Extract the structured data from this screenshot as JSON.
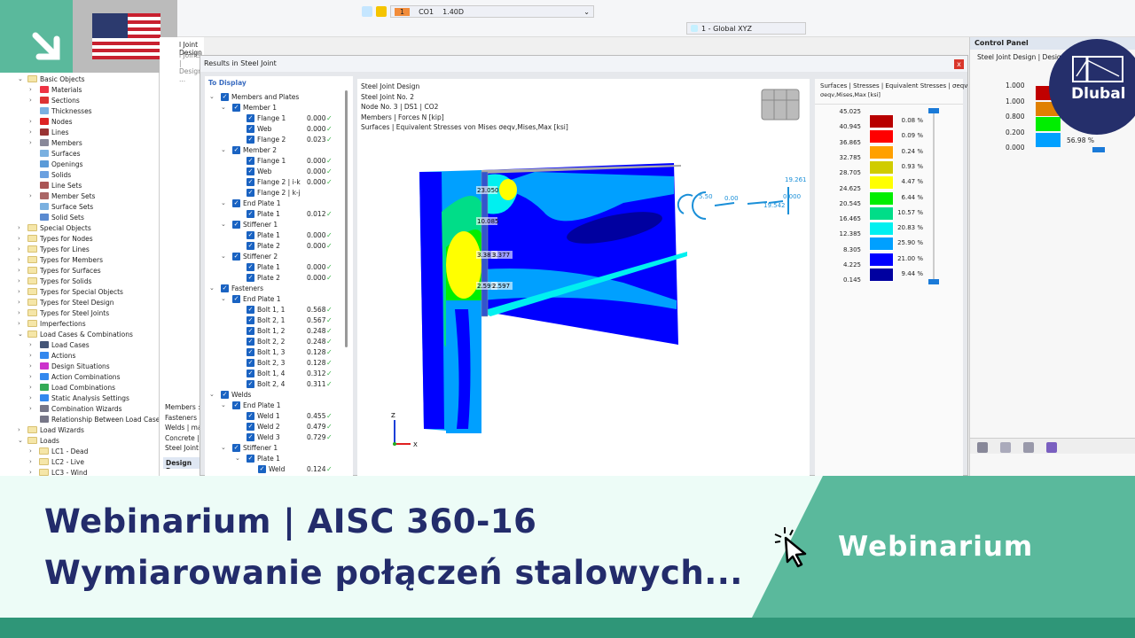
{
  "banner": {
    "line1": "Webinarium | AISC 360-16",
    "line2": "Wymiarowanie połączeń stalowych...",
    "badge": "Webinarium",
    "logo": "Dlubal",
    "colors": {
      "green": "#5ab99c",
      "dark_green": "#2f9678",
      "navy": "#232c6b",
      "mint": "#edfcf7"
    }
  },
  "toolbar": {
    "lc_number": "1",
    "lc_name": "CO1",
    "lc_factor": "1.40D",
    "coord_system": "1 - Global XYZ"
  },
  "left_tree": [
    {
      "l": 0,
      "e": "v",
      "i": "folder",
      "t": "Basic Objects"
    },
    {
      "l": 1,
      "e": ">",
      "i": "#e34",
      "t": "Materials"
    },
    {
      "l": 1,
      "e": ">",
      "i": "#d33",
      "t": "Sections"
    },
    {
      "l": 1,
      "e": "",
      "i": "#7ab0e0",
      "t": "Thicknesses"
    },
    {
      "l": 1,
      "e": ">",
      "i": "#d22",
      "t": "Nodes"
    },
    {
      "l": 1,
      "e": ">",
      "i": "#933",
      "t": "Lines"
    },
    {
      "l": 1,
      "e": ">",
      "i": "#889",
      "t": "Members"
    },
    {
      "l": 1,
      "e": "",
      "i": "#7ab0e0",
      "t": "Surfaces"
    },
    {
      "l": 1,
      "e": "",
      "i": "#5a9ad8",
      "t": "Openings"
    },
    {
      "l": 1,
      "e": "",
      "i": "#6aa0e0",
      "t": "Solids"
    },
    {
      "l": 1,
      "e": "",
      "i": "#a55",
      "t": "Line Sets"
    },
    {
      "l": 1,
      "e": ">",
      "i": "#a66",
      "t": "Member Sets"
    },
    {
      "l": 1,
      "e": "",
      "i": "#7ab0e0",
      "t": "Surface Sets"
    },
    {
      "l": 1,
      "e": "",
      "i": "#5a8ad0",
      "t": "Solid Sets"
    },
    {
      "l": 0,
      "e": ">",
      "i": "folder",
      "t": "Special Objects"
    },
    {
      "l": 0,
      "e": ">",
      "i": "folder",
      "t": "Types for Nodes"
    },
    {
      "l": 0,
      "e": ">",
      "i": "folder",
      "t": "Types for Lines"
    },
    {
      "l": 0,
      "e": ">",
      "i": "folder",
      "t": "Types for Members"
    },
    {
      "l": 0,
      "e": ">",
      "i": "folder",
      "t": "Types for Surfaces"
    },
    {
      "l": 0,
      "e": ">",
      "i": "folder",
      "t": "Types for Solids"
    },
    {
      "l": 0,
      "e": ">",
      "i": "folder",
      "t": "Types for Special Objects"
    },
    {
      "l": 0,
      "e": ">",
      "i": "folder",
      "t": "Types for Steel Design"
    },
    {
      "l": 0,
      "e": ">",
      "i": "folder",
      "t": "Types for Steel Joints"
    },
    {
      "l": 0,
      "e": ">",
      "i": "folder",
      "t": "Imperfections"
    },
    {
      "l": 0,
      "e": "v",
      "i": "folder",
      "t": "Load Cases & Combinations"
    },
    {
      "l": 1,
      "e": ">",
      "i": "#457",
      "t": "Load Cases"
    },
    {
      "l": 1,
      "e": ">",
      "i": "#38e",
      "t": "Actions"
    },
    {
      "l": 1,
      "e": ">",
      "i": "#c3c",
      "t": "Design Situations"
    },
    {
      "l": 1,
      "e": ">",
      "i": "#38e",
      "t": "Action Combinations"
    },
    {
      "l": 1,
      "e": ">",
      "i": "#3a5",
      "t": "Load Combinations"
    },
    {
      "l": 1,
      "e": ">",
      "i": "#38e",
      "t": "Static Analysis Settings"
    },
    {
      "l": 1,
      "e": ">",
      "i": "#778",
      "t": "Combination Wizards"
    },
    {
      "l": 1,
      "e": "",
      "i": "#778",
      "t": "Relationship Between Load Cases"
    },
    {
      "l": 0,
      "e": ">",
      "i": "folder",
      "t": "Load Wizards"
    },
    {
      "l": 0,
      "e": "v",
      "i": "folder",
      "t": "Loads"
    },
    {
      "l": 1,
      "e": ">",
      "i": "folder",
      "t": "LC1 - Dead"
    },
    {
      "l": 1,
      "e": ">",
      "i": "folder",
      "t": "LC2 - Live"
    },
    {
      "l": 1,
      "e": ">",
      "i": "folder",
      "t": "LC3 - Wind"
    }
  ],
  "mid_strip": {
    "header1": "l Joint Design",
    "header2": "l Joints | Design ...",
    "items": [
      "Members :",
      "Fasteners |",
      "Welds | ma",
      "Concrete |",
      "Steel Joint:"
    ],
    "design_tab": "Design Ra"
  },
  "dialog": {
    "title": "Results in Steel Joint",
    "close": "x",
    "to_display": "To Display"
  },
  "results_tree": [
    {
      "l": 0,
      "t": "Members and Plates",
      "v": ""
    },
    {
      "l": 1,
      "t": "Member 1",
      "v": ""
    },
    {
      "l": 2,
      "t": "Flange 1",
      "v": "0.000"
    },
    {
      "l": 2,
      "t": "Web",
      "v": "0.000"
    },
    {
      "l": 2,
      "t": "Flange 2",
      "v": "0.023"
    },
    {
      "l": 1,
      "t": "Member 2",
      "v": ""
    },
    {
      "l": 2,
      "t": "Flange 1",
      "v": "0.000"
    },
    {
      "l": 2,
      "t": "Web",
      "v": "0.000"
    },
    {
      "l": 2,
      "t": "Flange 2 | i-k",
      "v": "0.000"
    },
    {
      "l": 2,
      "t": "Flange 2 | k-j",
      "v": ""
    },
    {
      "l": 1,
      "t": "End Plate 1",
      "v": ""
    },
    {
      "l": 2,
      "t": "Plate 1",
      "v": "0.012"
    },
    {
      "l": 1,
      "t": "Stiffener 1",
      "v": ""
    },
    {
      "l": 2,
      "t": "Plate 1",
      "v": "0.000"
    },
    {
      "l": 2,
      "t": "Plate 2",
      "v": "0.000"
    },
    {
      "l": 1,
      "t": "Stiffener 2",
      "v": ""
    },
    {
      "l": 2,
      "t": "Plate 1",
      "v": "0.000"
    },
    {
      "l": 2,
      "t": "Plate 2",
      "v": "0.000"
    },
    {
      "l": 0,
      "t": "Fasteners",
      "v": ""
    },
    {
      "l": 1,
      "t": "End Plate 1",
      "v": ""
    },
    {
      "l": 2,
      "t": "Bolt 1, 1",
      "v": "0.568"
    },
    {
      "l": 2,
      "t": "Bolt 2, 1",
      "v": "0.567"
    },
    {
      "l": 2,
      "t": "Bolt 1, 2",
      "v": "0.248"
    },
    {
      "l": 2,
      "t": "Bolt 2, 2",
      "v": "0.248"
    },
    {
      "l": 2,
      "t": "Bolt 1, 3",
      "v": "0.128"
    },
    {
      "l": 2,
      "t": "Bolt 2, 3",
      "v": "0.128"
    },
    {
      "l": 2,
      "t": "Bolt 1, 4",
      "v": "0.312"
    },
    {
      "l": 2,
      "t": "Bolt 2, 4",
      "v": "0.311"
    },
    {
      "l": 0,
      "t": "Welds",
      "v": ""
    },
    {
      "l": 1,
      "t": "End Plate 1",
      "v": ""
    },
    {
      "l": 2,
      "t": "Weld 1",
      "v": "0.455"
    },
    {
      "l": 2,
      "t": "Weld 2",
      "v": "0.479"
    },
    {
      "l": 2,
      "t": "Weld 3",
      "v": "0.729"
    },
    {
      "l": 1,
      "t": "Stiffener 1",
      "v": ""
    },
    {
      "l": 2,
      "t": "Plate 1",
      "v": ""
    },
    {
      "l": 3,
      "t": "Weld",
      "v": "0.124"
    }
  ],
  "viewport": {
    "info": [
      "Steel Joint Design",
      "Steel Joint No. 2",
      "Node No. 3 | DS1 | CO2",
      "Members | Forces N [kip]",
      "Surfaces | Equivalent Stresses von Mises σeqv,Mises,Max [ksi]"
    ],
    "labels": [
      "23.050",
      "10.085",
      "3.383",
      "3.377",
      "2.599",
      "2.597"
    ],
    "forces": [
      "19.261",
      "0.000",
      "19.542",
      "0.00",
      "5.50"
    ],
    "axes": [
      "Z",
      "X"
    ]
  },
  "legend": {
    "title": "Surfaces | Stresses | Equivalent Stresses | σeqv",
    "subtitle": "σeqv,Mises,Max [ksi]",
    "values": [
      "45.025",
      "40.945",
      "36.865",
      "32.785",
      "28.705",
      "24.625",
      "20.545",
      "16.465",
      "12.385",
      "8.305",
      "4.225",
      "0.145"
    ],
    "colors": [
      "#b80000",
      "#ff0000",
      "#ffa000",
      "#d0cc00",
      "#ffff00",
      "#00ee00",
      "#00dd88",
      "#00f0f0",
      "#00a0ff",
      "#0000ff",
      "#0000a0"
    ],
    "percents": [
      "0.08 %",
      "0.09 %",
      "0.24 %",
      "0.93 %",
      "4.47 %",
      "6.44 %",
      "10.57 %",
      "20.83 %",
      "25.90 %",
      "21.00 %",
      "9.44 %"
    ]
  },
  "control_panel": {
    "title": "Control Panel",
    "subtitle": "Steel Joint Design | Design",
    "values": [
      "1.000",
      "1.000",
      "0.800",
      "0.200",
      "0.000"
    ],
    "colors": [
      "#c00000",
      "#e08000",
      "#00ee00",
      "#00a0ff"
    ],
    "percent": "56.98 %"
  }
}
